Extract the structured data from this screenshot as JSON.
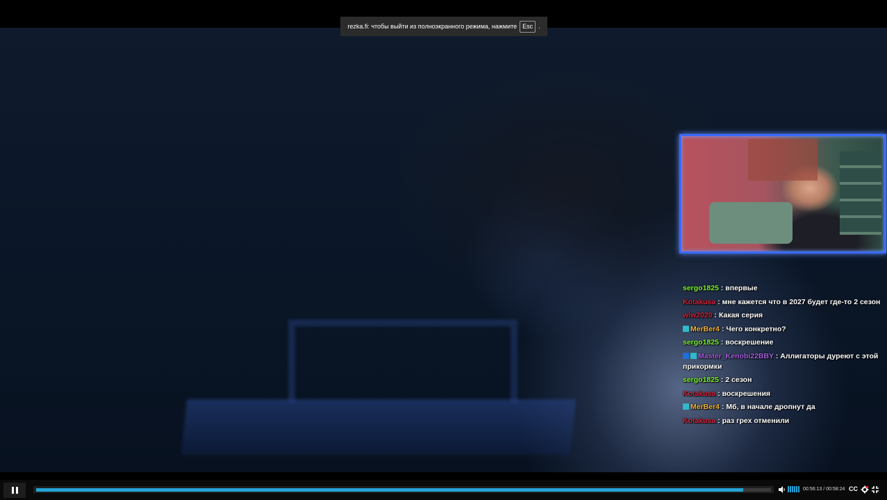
{
  "fullscreen_notice": {
    "text": "rezka.fi: чтобы выйти из полноэкранного режима, нажмите",
    "key": "Esc",
    "trailing": "."
  },
  "chat": [
    {
      "user": "sergo1825",
      "color": "#7cf235",
      "badges": [],
      "text": ": впервые"
    },
    {
      "user": "Kotakusa",
      "color": "#d0243b",
      "badges": [],
      "text": ": мне кажется что в 2027 будет где-то 2 сезон"
    },
    {
      "user": "wiw2020",
      "color": "#d0243b",
      "badges": [],
      "text": ": Какая серия"
    },
    {
      "user": "MerBer4",
      "color": "#f0b43d",
      "badges": [
        "prime"
      ],
      "text": ": Чего конкретно?"
    },
    {
      "user": "sergo1825",
      "color": "#7cf235",
      "badges": [],
      "text": ": воскрешение"
    },
    {
      "user": "Master_Kenobi22BBY",
      "color": "#a45fe0",
      "badges": [
        "turbo",
        "prime"
      ],
      "text": ": Аллигаторы дуреют с этой прикормки"
    },
    {
      "user": "sergo1825",
      "color": "#7cf235",
      "badges": [],
      "text": ": 2 сезон"
    },
    {
      "user": "Kotakusa",
      "color": "#d0243b",
      "badges": [],
      "text": ": воскрешения"
    },
    {
      "user": "MerBer4",
      "color": "#f0b43d",
      "badges": [
        "prime"
      ],
      "text": ": Мб, в начале дропнут да"
    },
    {
      "user": "Kotakusa",
      "color": "#d0243b",
      "badges": [],
      "text": ": раз грех отменили"
    }
  ],
  "player": {
    "current_time": "00:56:13",
    "separator": "/",
    "duration": "00:58:24",
    "progress_fraction": 0.962,
    "volume_level": 1.0,
    "accent_color": "#23a3d6",
    "cc_label": "CC",
    "icons": [
      "pause-icon",
      "volume-icon",
      "settings-icon",
      "fullscreen-exit-icon"
    ]
  }
}
